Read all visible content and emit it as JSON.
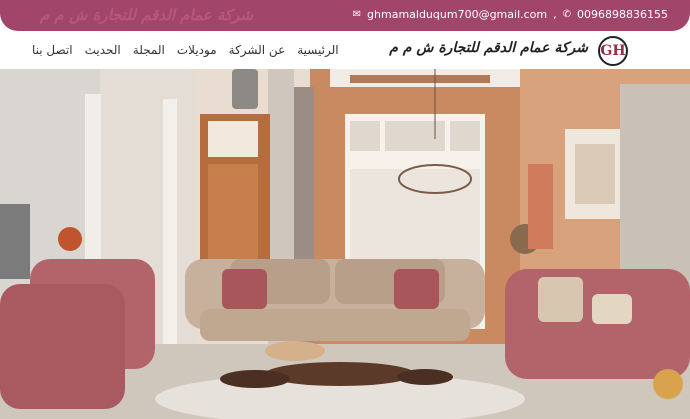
{
  "header": {
    "faded_title": "شركة عمام الدقم للتجارة ش م م",
    "email": "ghmamalduqum700@gmail.com",
    "phone": "0096898836155"
  },
  "brand": {
    "logo_text": "GH",
    "company_name": "شركة عمام الدقم للتجارة ش م م"
  },
  "nav": {
    "items": [
      "الرئيسية",
      "عن الشركة",
      "موديلات",
      "المجلة",
      "الحديث",
      "اتصل بنا"
    ]
  },
  "colors": {
    "accent": "#a2456a",
    "sofa": "#b3646a",
    "sofa_beige": "#c8b19c"
  }
}
